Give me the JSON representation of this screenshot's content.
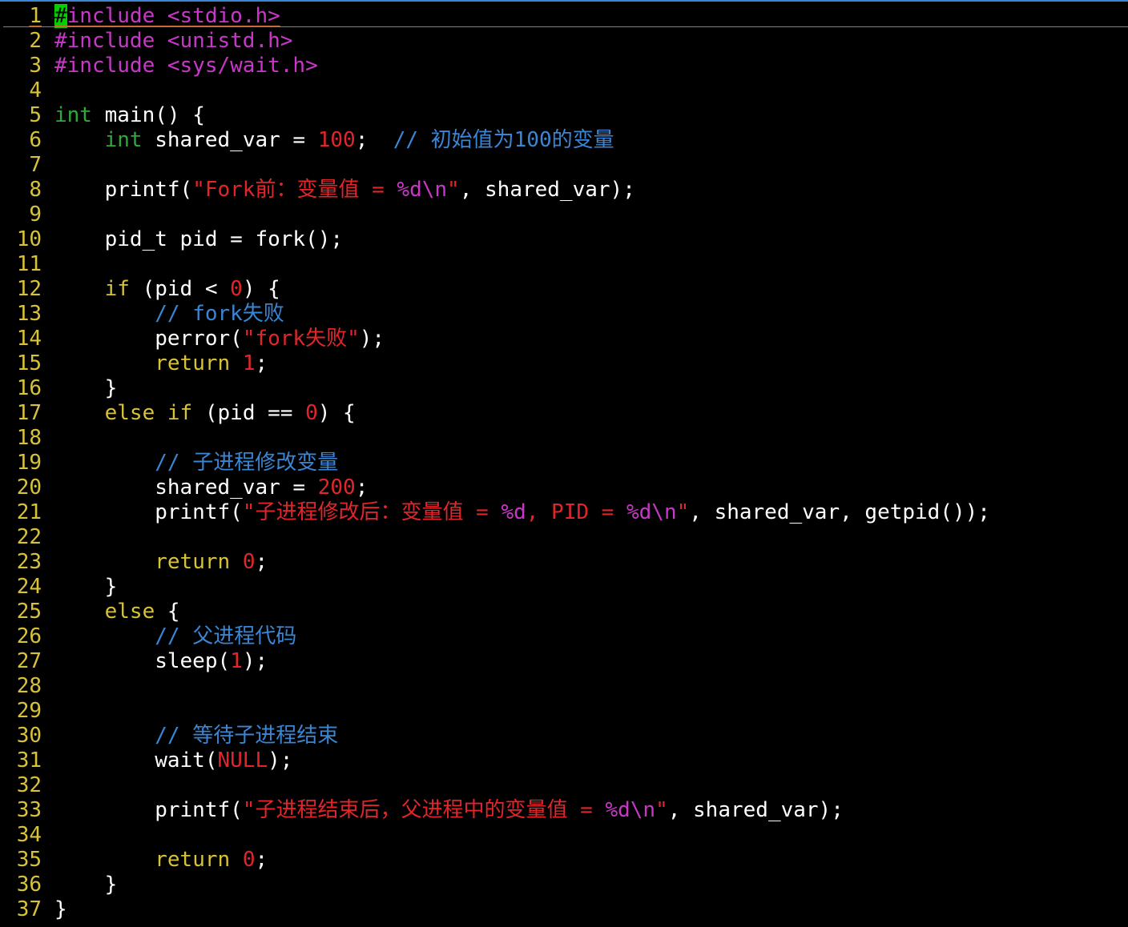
{
  "editor": {
    "lines": [
      {
        "n": "1",
        "tokens": [
          [
            "cursor",
            "#"
          ],
          [
            "pre",
            "include <stdio.h>"
          ]
        ]
      },
      {
        "n": "2",
        "tokens": [
          [
            "pre",
            "#include <unistd.h>"
          ]
        ]
      },
      {
        "n": "3",
        "tokens": [
          [
            "pre",
            "#include <sys/wait.h>"
          ]
        ]
      },
      {
        "n": "4",
        "tokens": []
      },
      {
        "n": "5",
        "tokens": [
          [
            "type",
            "int"
          ],
          [
            "plain",
            " main() {"
          ]
        ]
      },
      {
        "n": "6",
        "tokens": [
          [
            "plain",
            "    "
          ],
          [
            "type",
            "int"
          ],
          [
            "plain",
            " shared_var = "
          ],
          [
            "num",
            "100"
          ],
          [
            "plain",
            ";  "
          ],
          [
            "com",
            "// 初始值为100的变量"
          ]
        ]
      },
      {
        "n": "7",
        "tokens": []
      },
      {
        "n": "8",
        "tokens": [
          [
            "plain",
            "    printf("
          ],
          [
            "str",
            "\"Fork前：变量值 = "
          ],
          [
            "esc",
            "%d\\n"
          ],
          [
            "str",
            "\""
          ],
          [
            "plain",
            ", shared_var);"
          ]
        ]
      },
      {
        "n": "9",
        "tokens": []
      },
      {
        "n": "10",
        "tokens": [
          [
            "plain",
            "    pid_t pid = fork();"
          ]
        ]
      },
      {
        "n": "11",
        "tokens": []
      },
      {
        "n": "12",
        "tokens": [
          [
            "plain",
            "    "
          ],
          [
            "kw",
            "if"
          ],
          [
            "plain",
            " (pid < "
          ],
          [
            "num",
            "0"
          ],
          [
            "plain",
            ") {"
          ]
        ]
      },
      {
        "n": "13",
        "tokens": [
          [
            "plain",
            "        "
          ],
          [
            "com",
            "// fork失败"
          ]
        ]
      },
      {
        "n": "14",
        "tokens": [
          [
            "plain",
            "        perror("
          ],
          [
            "str",
            "\"fork失败\""
          ],
          [
            "plain",
            ");"
          ]
        ]
      },
      {
        "n": "15",
        "tokens": [
          [
            "plain",
            "        "
          ],
          [
            "kw",
            "return"
          ],
          [
            "plain",
            " "
          ],
          [
            "num",
            "1"
          ],
          [
            "plain",
            ";"
          ]
        ]
      },
      {
        "n": "16",
        "tokens": [
          [
            "plain",
            "    }"
          ]
        ]
      },
      {
        "n": "17",
        "tokens": [
          [
            "plain",
            "    "
          ],
          [
            "kw",
            "else if"
          ],
          [
            "plain",
            " (pid == "
          ],
          [
            "num",
            "0"
          ],
          [
            "plain",
            ") {"
          ]
        ]
      },
      {
        "n": "18",
        "tokens": []
      },
      {
        "n": "19",
        "tokens": [
          [
            "plain",
            "        "
          ],
          [
            "com",
            "// 子进程修改变量"
          ]
        ]
      },
      {
        "n": "20",
        "tokens": [
          [
            "plain",
            "        shared_var = "
          ],
          [
            "num",
            "200"
          ],
          [
            "plain",
            ";"
          ]
        ]
      },
      {
        "n": "21",
        "tokens": [
          [
            "plain",
            "        printf("
          ],
          [
            "str",
            "\"子进程修改后：变量值 = "
          ],
          [
            "esc",
            "%d"
          ],
          [
            "str",
            ", PID = "
          ],
          [
            "esc",
            "%d\\n"
          ],
          [
            "str",
            "\""
          ],
          [
            "plain",
            ", shared_var, getpid());"
          ]
        ]
      },
      {
        "n": "22",
        "tokens": []
      },
      {
        "n": "23",
        "tokens": [
          [
            "plain",
            "        "
          ],
          [
            "kw",
            "return"
          ],
          [
            "plain",
            " "
          ],
          [
            "num",
            "0"
          ],
          [
            "plain",
            ";"
          ]
        ]
      },
      {
        "n": "24",
        "tokens": [
          [
            "plain",
            "    }"
          ]
        ]
      },
      {
        "n": "25",
        "tokens": [
          [
            "plain",
            "    "
          ],
          [
            "kw",
            "else"
          ],
          [
            "plain",
            " {"
          ]
        ]
      },
      {
        "n": "26",
        "tokens": [
          [
            "plain",
            "        "
          ],
          [
            "com",
            "// 父进程代码"
          ]
        ]
      },
      {
        "n": "27",
        "tokens": [
          [
            "plain",
            "        sleep("
          ],
          [
            "num",
            "1"
          ],
          [
            "plain",
            ");"
          ]
        ]
      },
      {
        "n": "28",
        "tokens": []
      },
      {
        "n": "29",
        "tokens": []
      },
      {
        "n": "30",
        "tokens": [
          [
            "plain",
            "        "
          ],
          [
            "com",
            "// 等待子进程结束"
          ]
        ]
      },
      {
        "n": "31",
        "tokens": [
          [
            "plain",
            "        wait("
          ],
          [
            "num",
            "NULL"
          ],
          [
            "plain",
            ");"
          ]
        ]
      },
      {
        "n": "32",
        "tokens": []
      },
      {
        "n": "33",
        "tokens": [
          [
            "plain",
            "        printf("
          ],
          [
            "str",
            "\"子进程结束后，父进程中的变量值 = "
          ],
          [
            "esc",
            "%d\\n"
          ],
          [
            "str",
            "\""
          ],
          [
            "plain",
            ", shared_var);"
          ]
        ]
      },
      {
        "n": "34",
        "tokens": []
      },
      {
        "n": "35",
        "tokens": [
          [
            "plain",
            "        "
          ],
          [
            "kw",
            "return"
          ],
          [
            "plain",
            " "
          ],
          [
            "num",
            "0"
          ],
          [
            "plain",
            ";"
          ]
        ]
      },
      {
        "n": "36",
        "tokens": [
          [
            "plain",
            "    }"
          ]
        ]
      },
      {
        "n": "37",
        "tokens": [
          [
            "plain",
            "}"
          ]
        ]
      }
    ]
  },
  "colors": {
    "background": "#000000",
    "line_number": "#d7c238",
    "preprocessor": "#c838c8",
    "type": "#2fa83a",
    "keyword": "#d7c238",
    "string": "#e0262a",
    "comment": "#3a86d4",
    "cursor": "#00d000"
  }
}
